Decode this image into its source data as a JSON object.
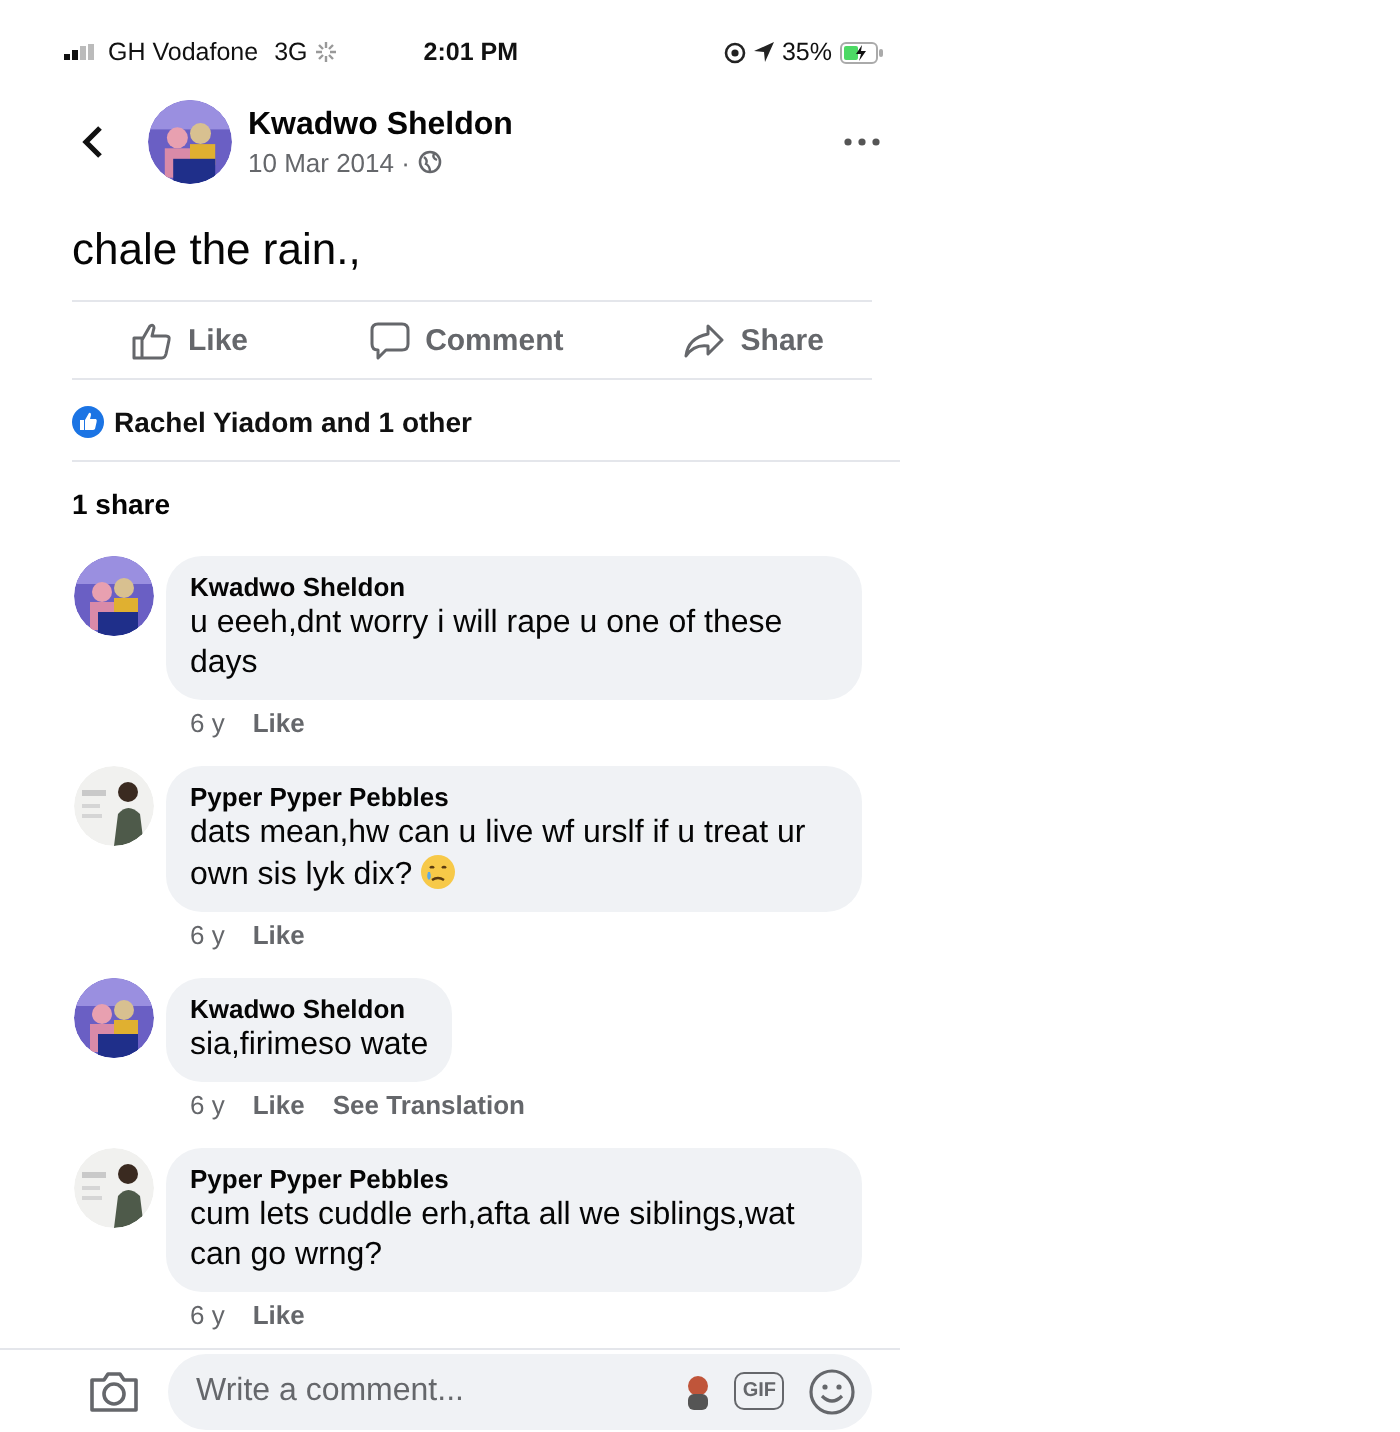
{
  "status_bar": {
    "carrier": "GH Vodafone",
    "network": "3G",
    "time": "2:01 PM",
    "battery": "35%"
  },
  "post": {
    "author": "Kwadwo Sheldon",
    "date": "10 Mar 2014 ·",
    "text": "chale the rain.,"
  },
  "actions": [
    {
      "label": "Like",
      "kind": "like"
    },
    {
      "label": "Comment",
      "kind": "comment"
    },
    {
      "label": "Share",
      "kind": "share"
    }
  ],
  "reactions": "Rachel Yiadom and 1 other",
  "shares": "1 share",
  "comments": [
    {
      "author": "Kwadwo Sheldon",
      "text": "u eeeh,dnt worry i will rape u one of these days",
      "age": "6 y",
      "links": [
        "Like"
      ]
    },
    {
      "author": "Pyper Pyper Pebbles",
      "text": "dats mean,hw can u live wf urslf if u treat ur own sis lyk dix?",
      "emoji": true,
      "age": "6 y",
      "links": [
        "Like"
      ]
    },
    {
      "author": "Kwadwo Sheldon",
      "text": "sia,firimeso wate",
      "age": "6 y",
      "links": [
        "Like",
        "See Translation"
      ]
    },
    {
      "author": "Pyper Pyper Pebbles",
      "text": "cum lets cuddle erh,afta all we siblings,wat can go wrng?",
      "age": "6 y",
      "links": [
        "Like"
      ]
    }
  ],
  "composer": {
    "placeholder": "Write a comment...",
    "gif": "GIF"
  }
}
